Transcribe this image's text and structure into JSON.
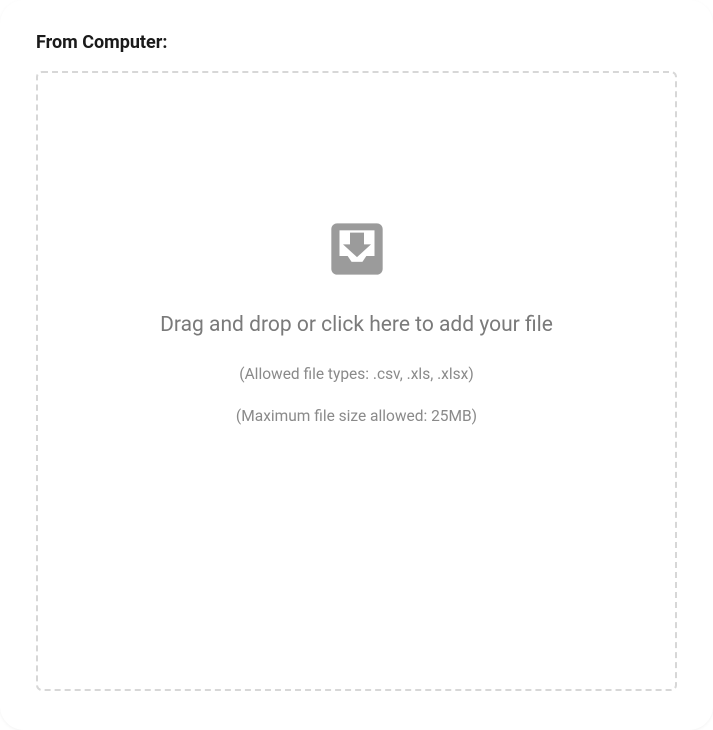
{
  "section": {
    "title": "From Computer:"
  },
  "dropzone": {
    "main_text": "Drag and drop or click here to add your file",
    "allowed_types_text": "(Allowed file types: .csv, .xls, .xlsx)",
    "max_size_text": "(Maximum file size allowed: 25MB)"
  }
}
